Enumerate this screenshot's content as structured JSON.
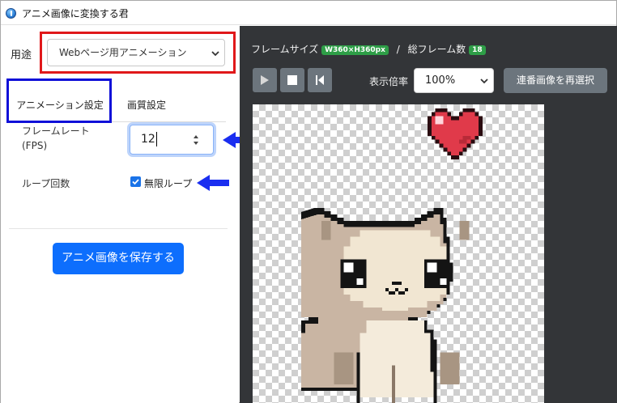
{
  "window": {
    "title": "アニメ画像に変換する君"
  },
  "left": {
    "usage_label": "用途",
    "usage_value": "Webページ用アニメーション",
    "tabs": [
      {
        "label": "アニメーション設定",
        "active": true
      },
      {
        "label": "画質設定",
        "active": false
      }
    ],
    "fps_label_line1": "フレームレート",
    "fps_label_line2": "(FPS)",
    "fps_value": "12",
    "loop_label": "ループ回数",
    "loop_checked": true,
    "loop_text": "無限ループ",
    "save_button": "アニメ画像を保存する"
  },
  "right": {
    "frame_size_label": "フレームサイズ",
    "frame_size_value": "W360×H360px",
    "separator": "/",
    "total_frames_label": "総フレーム数",
    "total_frames_value": "18",
    "zoom_label": "表示倍率",
    "zoom_value": "100%",
    "reselect_button": "連番画像を再選択"
  },
  "colors": {
    "annotation_red": "#e0181a",
    "annotation_blue": "#1010d8",
    "arrow_blue": "#1a2ef0",
    "primary": "#0d6efd",
    "badge_green": "#2e9e47",
    "dark_panel": "#333538"
  },
  "icons": [
    "app-icon",
    "chevron-down-icon",
    "spinner-arrows-icon",
    "checkmark-icon",
    "play-icon",
    "stop-icon",
    "step-back-icon",
    "arrow-left-icon"
  ]
}
